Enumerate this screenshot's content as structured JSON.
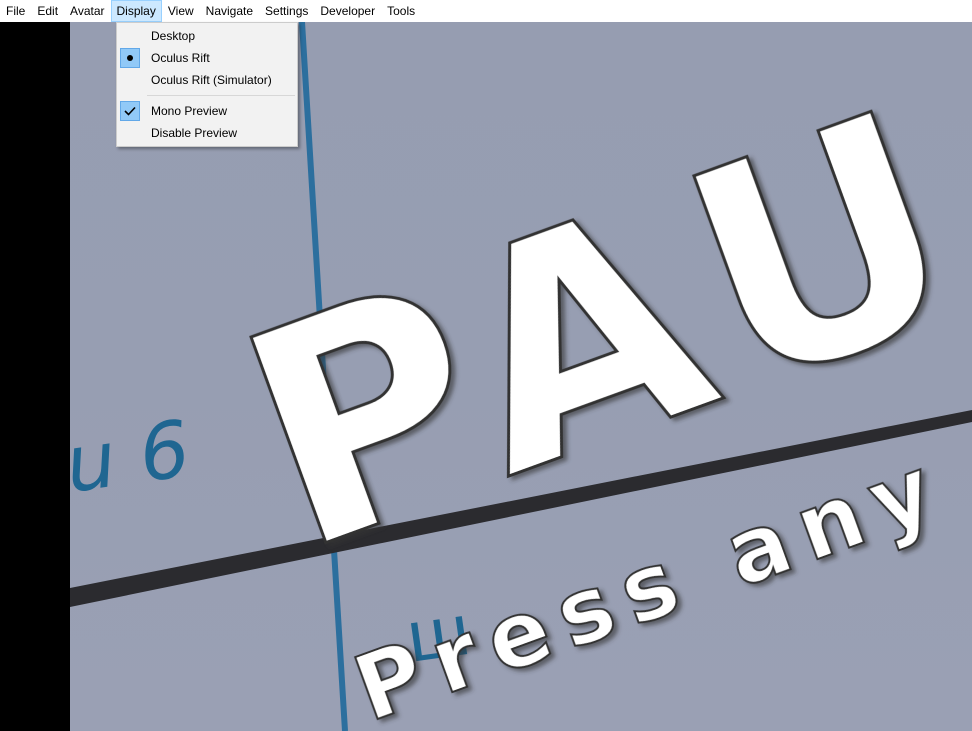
{
  "menubar": {
    "items": [
      {
        "label": "File"
      },
      {
        "label": "Edit"
      },
      {
        "label": "Avatar"
      },
      {
        "label": "Display"
      },
      {
        "label": "View"
      },
      {
        "label": "Navigate"
      },
      {
        "label": "Settings"
      },
      {
        "label": "Developer"
      },
      {
        "label": "Tools"
      }
    ]
  },
  "display_menu": {
    "items": [
      {
        "label": "Desktop",
        "state": "none"
      },
      {
        "label": "Oculus Rift",
        "state": "radio-selected"
      },
      {
        "label": "Oculus Rift (Simulator)",
        "state": "none"
      },
      {
        "label": "Mono Preview",
        "state": "checked"
      },
      {
        "label": "Disable Preview",
        "state": "none"
      }
    ]
  },
  "scene": {
    "pause_text": "PAU",
    "press_text": "Press any",
    "left_text": "u 6",
    "accent_color": "#1f6691",
    "background_color": "#979eb2"
  }
}
